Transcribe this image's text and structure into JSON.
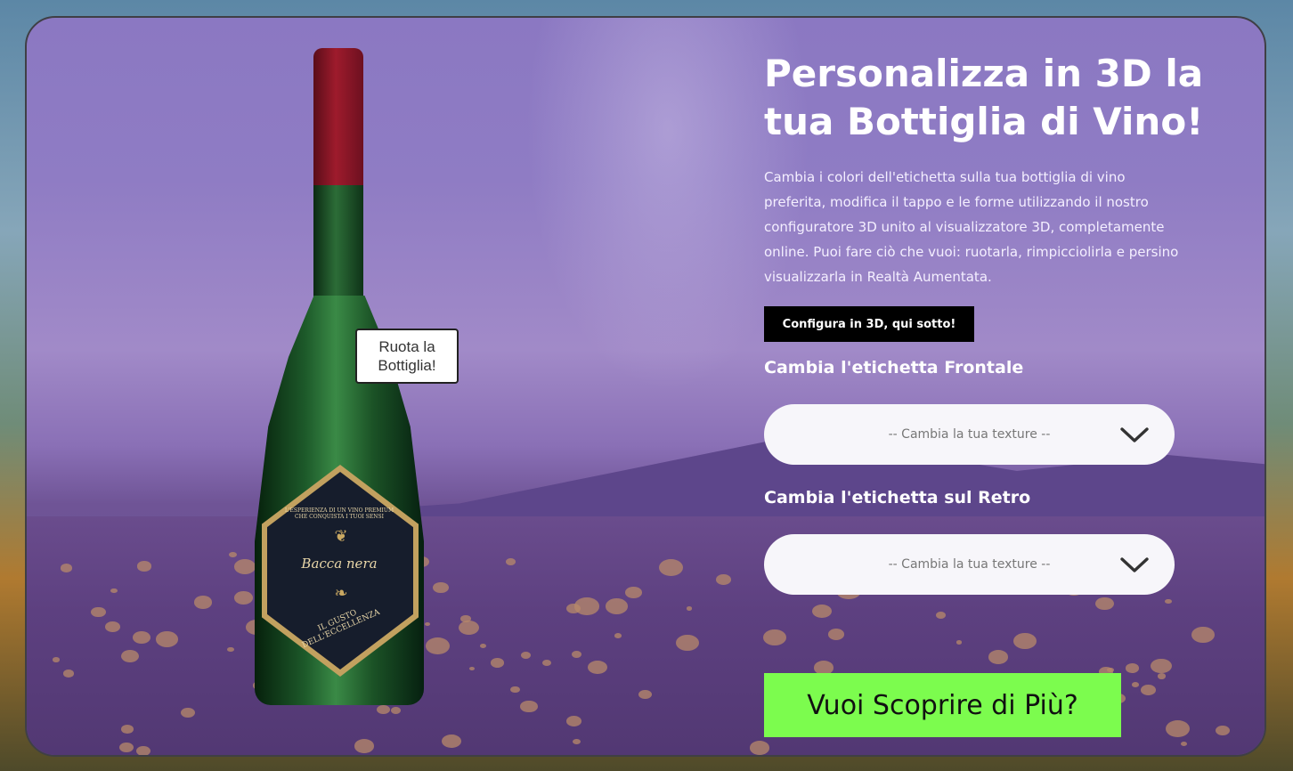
{
  "hero": {
    "title": "Personalizza in 3D la tua Bottiglia di Vino!",
    "description": "Cambia i colori dell'etichetta sulla tua bottiglia di vino preferita, modifica il tappo e le forme utilizzando il nostro configuratore 3D unito al visualizzatore 3D, completamente online. Puoi fare ciò che vuoi: ruotarla, rimpicciolirla e persino visualizzarla in Realtà Aumentata.",
    "configure_button": "Configura in 3D, qui sotto!"
  },
  "viewer": {
    "tooltip": "Ruota la Bottiglia!",
    "label_top": "L'ESPERIENZA DI UN VINO PREMIUM CHE CONQUISTA I TUOI SENSI",
    "label_name": "Bacca nera",
    "label_bottom": "IL GUSTO DELL'ECCELLENZA"
  },
  "front_label": {
    "title": "Cambia l'etichetta Frontale",
    "select_value": "-- Cambia la tua texture --"
  },
  "back_label": {
    "title": "Cambia l'etichetta sul Retro",
    "select_value": "-- Cambia la tua texture --"
  },
  "cta": {
    "label": "Vuoi Scoprire di Più?"
  },
  "colors": {
    "cta_background": "#7cfc4e",
    "button_background": "#000000",
    "card_purple": "#8f7cc4"
  },
  "icons": {
    "select_arrow": "chevron-down-icon"
  }
}
